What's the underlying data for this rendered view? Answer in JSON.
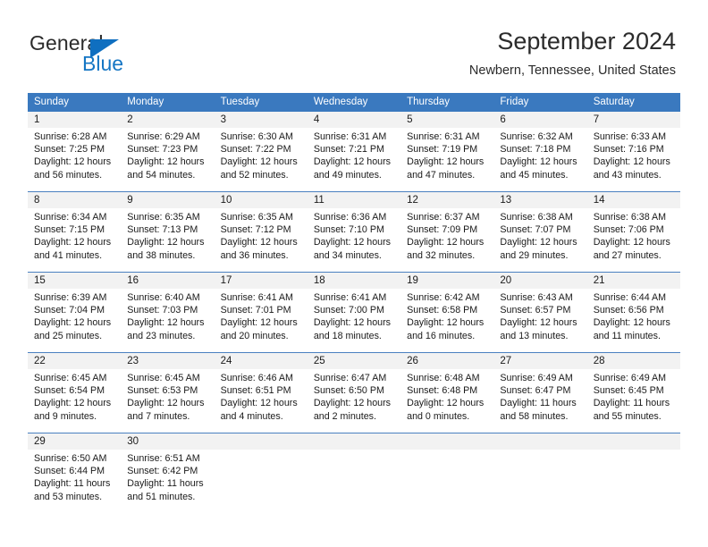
{
  "brand": {
    "name_part1": "General",
    "name_part2": "Blue",
    "triangle_color": "#0f6fc0",
    "blue_color": "#1576c4"
  },
  "header": {
    "title": "September 2024",
    "subtitle": "Newbern, Tennessee, United States"
  },
  "theme": {
    "header_row_bg": "#3a79bf",
    "date_band_bg": "#f2f2f2",
    "separator": "#4a80c0",
    "text": "#1a1a1a"
  },
  "weekdays": [
    "Sunday",
    "Monday",
    "Tuesday",
    "Wednesday",
    "Thursday",
    "Friday",
    "Saturday"
  ],
  "weeks": [
    {
      "days": [
        {
          "num": "1",
          "sunrise": "Sunrise: 6:28 AM",
          "sunset": "Sunset: 7:25 PM",
          "daylight1": "Daylight: 12 hours",
          "daylight2": "and 56 minutes."
        },
        {
          "num": "2",
          "sunrise": "Sunrise: 6:29 AM",
          "sunset": "Sunset: 7:23 PM",
          "daylight1": "Daylight: 12 hours",
          "daylight2": "and 54 minutes."
        },
        {
          "num": "3",
          "sunrise": "Sunrise: 6:30 AM",
          "sunset": "Sunset: 7:22 PM",
          "daylight1": "Daylight: 12 hours",
          "daylight2": "and 52 minutes."
        },
        {
          "num": "4",
          "sunrise": "Sunrise: 6:31 AM",
          "sunset": "Sunset: 7:21 PM",
          "daylight1": "Daylight: 12 hours",
          "daylight2": "and 49 minutes."
        },
        {
          "num": "5",
          "sunrise": "Sunrise: 6:31 AM",
          "sunset": "Sunset: 7:19 PM",
          "daylight1": "Daylight: 12 hours",
          "daylight2": "and 47 minutes."
        },
        {
          "num": "6",
          "sunrise": "Sunrise: 6:32 AM",
          "sunset": "Sunset: 7:18 PM",
          "daylight1": "Daylight: 12 hours",
          "daylight2": "and 45 minutes."
        },
        {
          "num": "7",
          "sunrise": "Sunrise: 6:33 AM",
          "sunset": "Sunset: 7:16 PM",
          "daylight1": "Daylight: 12 hours",
          "daylight2": "and 43 minutes."
        }
      ]
    },
    {
      "days": [
        {
          "num": "8",
          "sunrise": "Sunrise: 6:34 AM",
          "sunset": "Sunset: 7:15 PM",
          "daylight1": "Daylight: 12 hours",
          "daylight2": "and 41 minutes."
        },
        {
          "num": "9",
          "sunrise": "Sunrise: 6:35 AM",
          "sunset": "Sunset: 7:13 PM",
          "daylight1": "Daylight: 12 hours",
          "daylight2": "and 38 minutes."
        },
        {
          "num": "10",
          "sunrise": "Sunrise: 6:35 AM",
          "sunset": "Sunset: 7:12 PM",
          "daylight1": "Daylight: 12 hours",
          "daylight2": "and 36 minutes."
        },
        {
          "num": "11",
          "sunrise": "Sunrise: 6:36 AM",
          "sunset": "Sunset: 7:10 PM",
          "daylight1": "Daylight: 12 hours",
          "daylight2": "and 34 minutes."
        },
        {
          "num": "12",
          "sunrise": "Sunrise: 6:37 AM",
          "sunset": "Sunset: 7:09 PM",
          "daylight1": "Daylight: 12 hours",
          "daylight2": "and 32 minutes."
        },
        {
          "num": "13",
          "sunrise": "Sunrise: 6:38 AM",
          "sunset": "Sunset: 7:07 PM",
          "daylight1": "Daylight: 12 hours",
          "daylight2": "and 29 minutes."
        },
        {
          "num": "14",
          "sunrise": "Sunrise: 6:38 AM",
          "sunset": "Sunset: 7:06 PM",
          "daylight1": "Daylight: 12 hours",
          "daylight2": "and 27 minutes."
        }
      ]
    },
    {
      "days": [
        {
          "num": "15",
          "sunrise": "Sunrise: 6:39 AM",
          "sunset": "Sunset: 7:04 PM",
          "daylight1": "Daylight: 12 hours",
          "daylight2": "and 25 minutes."
        },
        {
          "num": "16",
          "sunrise": "Sunrise: 6:40 AM",
          "sunset": "Sunset: 7:03 PM",
          "daylight1": "Daylight: 12 hours",
          "daylight2": "and 23 minutes."
        },
        {
          "num": "17",
          "sunrise": "Sunrise: 6:41 AM",
          "sunset": "Sunset: 7:01 PM",
          "daylight1": "Daylight: 12 hours",
          "daylight2": "and 20 minutes."
        },
        {
          "num": "18",
          "sunrise": "Sunrise: 6:41 AM",
          "sunset": "Sunset: 7:00 PM",
          "daylight1": "Daylight: 12 hours",
          "daylight2": "and 18 minutes."
        },
        {
          "num": "19",
          "sunrise": "Sunrise: 6:42 AM",
          "sunset": "Sunset: 6:58 PM",
          "daylight1": "Daylight: 12 hours",
          "daylight2": "and 16 minutes."
        },
        {
          "num": "20",
          "sunrise": "Sunrise: 6:43 AM",
          "sunset": "Sunset: 6:57 PM",
          "daylight1": "Daylight: 12 hours",
          "daylight2": "and 13 minutes."
        },
        {
          "num": "21",
          "sunrise": "Sunrise: 6:44 AM",
          "sunset": "Sunset: 6:56 PM",
          "daylight1": "Daylight: 12 hours",
          "daylight2": "and 11 minutes."
        }
      ]
    },
    {
      "days": [
        {
          "num": "22",
          "sunrise": "Sunrise: 6:45 AM",
          "sunset": "Sunset: 6:54 PM",
          "daylight1": "Daylight: 12 hours",
          "daylight2": "and 9 minutes."
        },
        {
          "num": "23",
          "sunrise": "Sunrise: 6:45 AM",
          "sunset": "Sunset: 6:53 PM",
          "daylight1": "Daylight: 12 hours",
          "daylight2": "and 7 minutes."
        },
        {
          "num": "24",
          "sunrise": "Sunrise: 6:46 AM",
          "sunset": "Sunset: 6:51 PM",
          "daylight1": "Daylight: 12 hours",
          "daylight2": "and 4 minutes."
        },
        {
          "num": "25",
          "sunrise": "Sunrise: 6:47 AM",
          "sunset": "Sunset: 6:50 PM",
          "daylight1": "Daylight: 12 hours",
          "daylight2": "and 2 minutes."
        },
        {
          "num": "26",
          "sunrise": "Sunrise: 6:48 AM",
          "sunset": "Sunset: 6:48 PM",
          "daylight1": "Daylight: 12 hours",
          "daylight2": "and 0 minutes."
        },
        {
          "num": "27",
          "sunrise": "Sunrise: 6:49 AM",
          "sunset": "Sunset: 6:47 PM",
          "daylight1": "Daylight: 11 hours",
          "daylight2": "and 58 minutes."
        },
        {
          "num": "28",
          "sunrise": "Sunrise: 6:49 AM",
          "sunset": "Sunset: 6:45 PM",
          "daylight1": "Daylight: 11 hours",
          "daylight2": "and 55 minutes."
        }
      ]
    },
    {
      "days": [
        {
          "num": "29",
          "sunrise": "Sunrise: 6:50 AM",
          "sunset": "Sunset: 6:44 PM",
          "daylight1": "Daylight: 11 hours",
          "daylight2": "and 53 minutes."
        },
        {
          "num": "30",
          "sunrise": "Sunrise: 6:51 AM",
          "sunset": "Sunset: 6:42 PM",
          "daylight1": "Daylight: 11 hours",
          "daylight2": "and 51 minutes."
        },
        {
          "num": "",
          "sunrise": "",
          "sunset": "",
          "daylight1": "",
          "daylight2": ""
        },
        {
          "num": "",
          "sunrise": "",
          "sunset": "",
          "daylight1": "",
          "daylight2": ""
        },
        {
          "num": "",
          "sunrise": "",
          "sunset": "",
          "daylight1": "",
          "daylight2": ""
        },
        {
          "num": "",
          "sunrise": "",
          "sunset": "",
          "daylight1": "",
          "daylight2": ""
        },
        {
          "num": "",
          "sunrise": "",
          "sunset": "",
          "daylight1": "",
          "daylight2": ""
        }
      ]
    }
  ]
}
